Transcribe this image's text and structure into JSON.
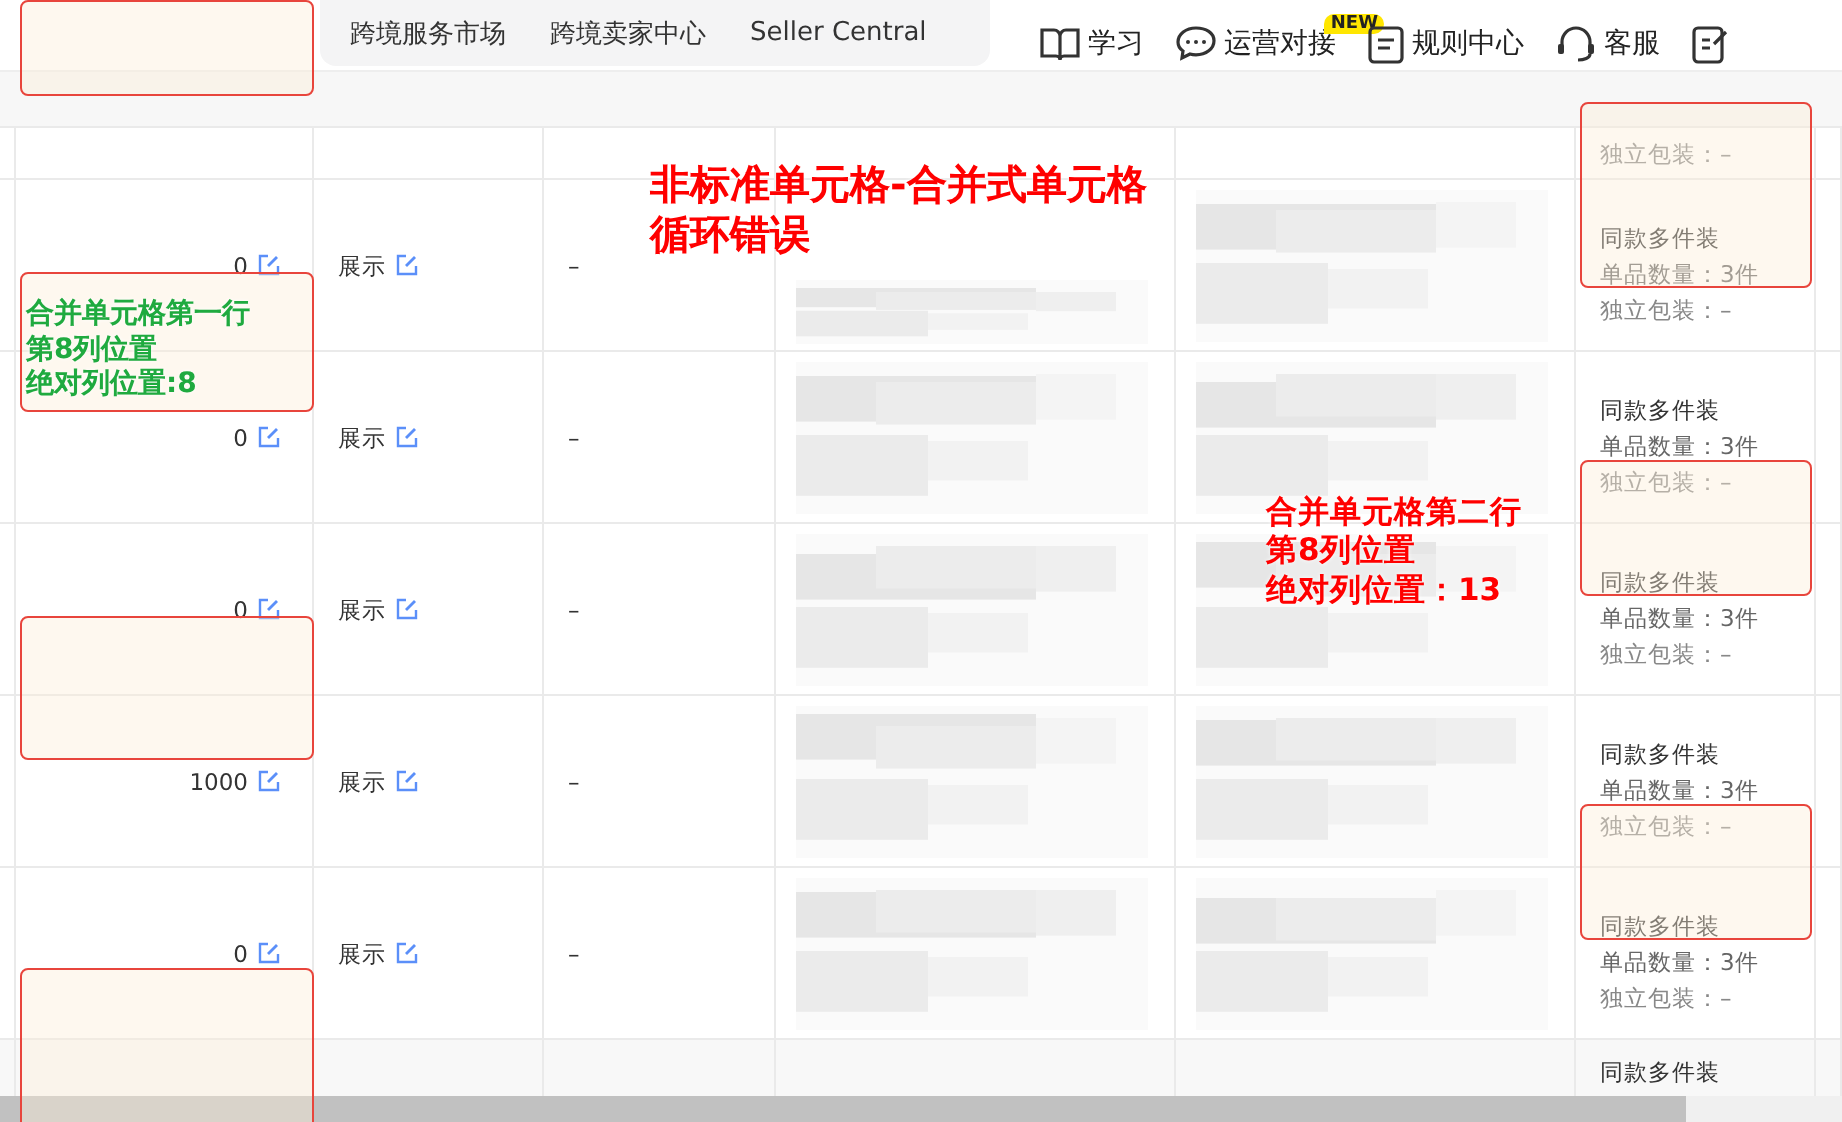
{
  "nav": {
    "tabs": [
      "跨境服务市场",
      "跨境卖家中心",
      "Seller Central"
    ],
    "links": [
      {
        "kind": "book",
        "label": "学习"
      },
      {
        "kind": "chat",
        "label": "运营对接",
        "badge": "NEW"
      },
      {
        "kind": "doc",
        "label": "规则中心"
      },
      {
        "kind": "headset",
        "label": "客服"
      },
      {
        "kind": "edit"
      }
    ]
  },
  "table": {
    "top_row": {
      "individual": "独立包装：–"
    },
    "rows": [
      {
        "quantity": "0",
        "display": "展示",
        "note": "–",
        "pack": {
          "title": "同款多件装",
          "count": "单品数量：3件",
          "individual": "独立包装：–"
        }
      },
      {
        "quantity": "0",
        "display": "展示",
        "note": "–",
        "pack": {
          "title": "同款多件装",
          "count": "单品数量：3件",
          "individual": "独立包装：–"
        }
      },
      {
        "quantity": "0",
        "display": "展示",
        "note": "–",
        "pack": {
          "title": "同款多件装",
          "count": "单品数量：3件",
          "individual": "独立包装：–"
        }
      },
      {
        "quantity": "1000",
        "display": "展示",
        "note": "–",
        "pack": {
          "title": "同款多件装",
          "count": "单品数量：3件",
          "individual": "独立包装：–"
        }
      },
      {
        "quantity": "0",
        "display": "展示",
        "note": "–",
        "pack": {
          "title": "同款多件装",
          "count": "单品数量：3件",
          "individual": "独立包装：–"
        }
      }
    ],
    "bottom_row": {
      "title": "同款多件装"
    }
  },
  "annotations": [
    {
      "kind": "title",
      "color": "#ff0000",
      "lines": [
        "非标准单元格-合并式单元格",
        "循环错误"
      ]
    },
    {
      "kind": "note-left",
      "color": "#1faa3f",
      "lines": [
        "合并单元格第一行",
        "第8列位置",
        "绝对列位置:8"
      ]
    },
    {
      "kind": "note-right",
      "color": "#ff0000",
      "lines": [
        "合并单元格第二行",
        "第8列位置",
        "绝对列位置：13"
      ]
    }
  ]
}
